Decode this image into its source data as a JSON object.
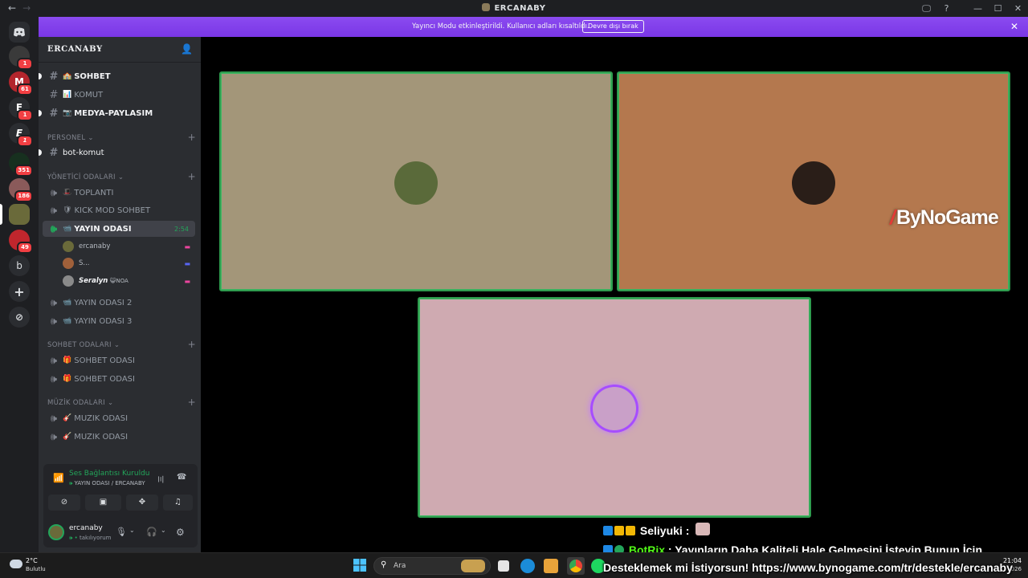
{
  "window": {
    "title": "ERCANABY",
    "back_glyph": "←",
    "forward_glyph": "→",
    "controls": [
      "🖵",
      "?",
      "—",
      "☐",
      "✕"
    ]
  },
  "rail": {
    "servers": [
      {
        "letter": "",
        "badge": "1",
        "color": "#3a3a3a"
      },
      {
        "letter": "M",
        "badge": "61",
        "color": "#b3262d"
      },
      {
        "letter": "E",
        "badge": "1",
        "color": "#2b2d31"
      },
      {
        "letter": "E",
        "badge": "1",
        "color": "#2b2d31"
      },
      {
        "letter": "",
        "badge": "351",
        "color": "#17301f"
      },
      {
        "letter": "",
        "badge": "186",
        "color": "#8a5a5a"
      },
      {
        "letter": "",
        "badge": "",
        "color": "#6a6a3a"
      },
      {
        "letter": "",
        "badge": "49",
        "color": "#c0262d"
      },
      {
        "letter": "b",
        "badge": "",
        "color": "#2b2d31"
      }
    ],
    "add_glyph": "+",
    "explore_glyph": "⊘"
  },
  "sidebar": {
    "server_name": "ERCANABY",
    "text_channels": [
      {
        "name": "SOHBET",
        "emoji": "🏫"
      },
      {
        "name": "KOMUT",
        "emoji": "📊"
      },
      {
        "name": "MEDYA-PAYLASIM",
        "emoji": "📷"
      }
    ],
    "categories": {
      "personel": "PERSONEL",
      "yonetici": "YÖNETİCİ ODALARI",
      "sohbet": "SOHBET ODALARI",
      "muzik": "MÜZİK ODALARI"
    },
    "personel_channel": "bot-komut",
    "yonetici_channels": [
      {
        "name": "TOPLANTI",
        "emoji": "🎩"
      },
      {
        "name": "KICK MOD SOHBET",
        "emoji": "🛡"
      },
      {
        "name": "YAYIN ODASI",
        "emoji": "📹",
        "time": "2:54"
      }
    ],
    "voice_users": [
      {
        "name": "ercanaby",
        "tag": "",
        "color": "#6a6a3a"
      },
      {
        "name": "S...",
        "tag": "",
        "color": "#a0603a"
      },
      {
        "name": "Seralyn",
        "tag": "😺NOA",
        "color": "#8a8a8a"
      }
    ],
    "more_yayin": [
      {
        "name": "YAYIN ODASI 2",
        "emoji": "📹"
      },
      {
        "name": "YAYIN ODASI 3",
        "emoji": "📹"
      }
    ],
    "sohbet_channels": [
      {
        "name": "SOHBET ODASI",
        "emoji": "🎁"
      },
      {
        "name": "SOHBET ODASI",
        "emoji": "🎁"
      }
    ],
    "muzik_channels": [
      {
        "name": "MUZIK ODASI",
        "emoji": "🎸"
      },
      {
        "name": "MUZIK ODASI",
        "emoji": "🎸"
      }
    ]
  },
  "voice_panel": {
    "status": "Ses Bağlantısı Kuruldu",
    "sub": "YAYIN ODASI / ERCANABY",
    "username": "ercanaby",
    "user_status": "takılıyorum"
  },
  "banner": {
    "message": "Yayıncı Modu etkinleştirildi. Kullanıcı adları kısaltıldı.",
    "button": "Devre dışı bırak",
    "close_glyph": "✕"
  },
  "tiles": [
    {
      "bg": "#a39679",
      "avatar": "#5a6a3a"
    },
    {
      "bg": "#b4784e",
      "avatar": "#2a1e18"
    },
    {
      "bg": "#cfaab1",
      "avatar": "#c9a0c8"
    }
  ],
  "overlay": {
    "brand": "ByNoGame",
    "chat_user": "Seliyuki :",
    "chat_bot": "BotRix",
    "chat_line1": ": Yayınların Daha Kaliteli Hale Gelmesini İsteyip Bunun İçin",
    "chat_line2": "Desteklemek mi İstiyorsun! https://www.bynogame.com/tr/destekle/ercanaby"
  },
  "taskbar": {
    "temp": "2°C",
    "condition": "Bulutlu",
    "search_placeholder": "Ara",
    "time": "21:04",
    "date": "026"
  }
}
